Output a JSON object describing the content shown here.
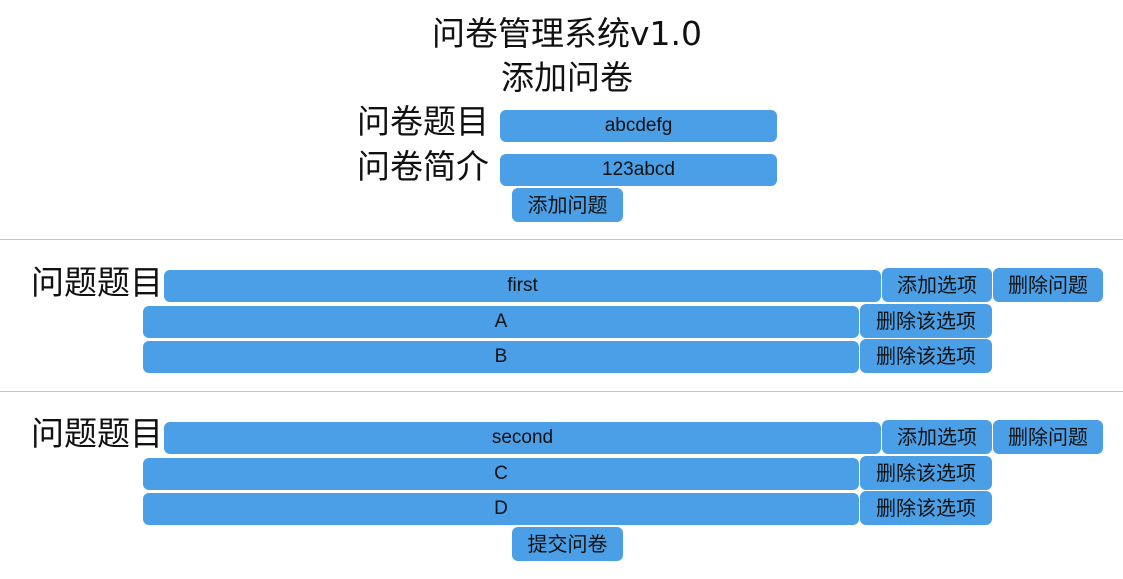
{
  "app_title": "问卷管理系统v1.0",
  "page_heading": "添加问卷",
  "survey_form": {
    "title_label": "问卷题目",
    "title_value": "abcdefg",
    "intro_label": "问卷简介",
    "intro_value": "123abcd",
    "add_question_label": "添加问题"
  },
  "questions": [
    {
      "label": "问题题目",
      "value": "first",
      "add_option_label": "添加选项",
      "delete_question_label": "删除问题",
      "options": [
        {
          "value": "A",
          "delete_label": "删除该选项"
        },
        {
          "value": "B",
          "delete_label": "删除该选项"
        }
      ]
    },
    {
      "label": "问题题目",
      "value": "second",
      "add_option_label": "添加选项",
      "delete_question_label": "删除问题",
      "options": [
        {
          "value": "C",
          "delete_label": "删除该选项"
        },
        {
          "value": "D",
          "delete_label": "删除该选项"
        }
      ]
    }
  ],
  "submit_label": "提交问卷",
  "colors": {
    "accent": "#4a9fe6",
    "divider": "#c8c8c8"
  }
}
